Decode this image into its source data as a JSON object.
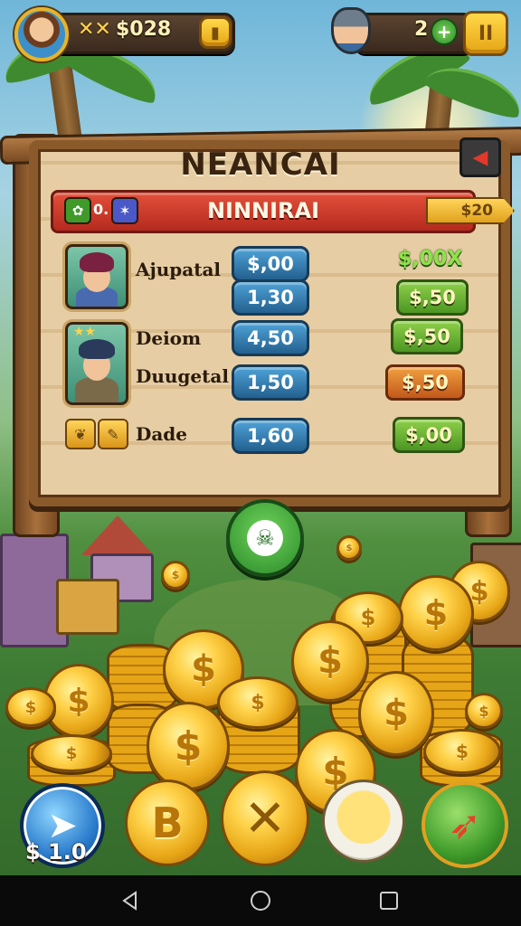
{
  "top_bar": {
    "currency_icon": "crossed-swords-icon",
    "currency_label": "$028",
    "right_counter": "2",
    "plus_label": "+",
    "pause_label": "II"
  },
  "board": {
    "title": "NEANCAI",
    "banner": {
      "title": "NINNIRAI",
      "left_chip_text": "0.",
      "reward_tag": "$20"
    },
    "rows": [
      {
        "name": "Ajupatal",
        "value": "$,00",
        "price": "$,00X"
      },
      {
        "name": "",
        "value": "1,30",
        "price": "$,50"
      },
      {
        "name": "Deiom",
        "value": "4,50",
        "price": "$,50"
      },
      {
        "name": "Duugetal",
        "value": "1,50",
        "price": "$,50"
      },
      {
        "name": "Dade",
        "value": "1,60",
        "price": "$,00"
      }
    ]
  },
  "bottom": {
    "left_amount": "$ 1.0",
    "coin_letter": "B"
  },
  "colors": {
    "wood": "#8b5a2b",
    "banner_red": "#c8352a",
    "value_blue": "#2f7bb3",
    "price_green": "#5aa82c",
    "price_orange": "#d46a24",
    "gold": "#ffd24a"
  }
}
